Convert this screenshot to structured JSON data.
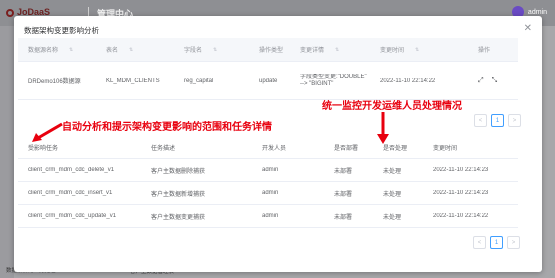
{
  "background": {
    "logo_text": "JoDaaS",
    "app_title": "管理中心",
    "user_name": "admin",
    "bottom_left_text": "数据解析的业务处理",
    "bottom_mid_text": "客户主数据管理表"
  },
  "modal": {
    "title": "数据架构变更影响分析",
    "close_icon": "close-icon"
  },
  "table1": {
    "columns": [
      "数据源名称",
      "表名",
      "字段名",
      "操作类型",
      "变更详情",
      "变更时间",
      "操作"
    ],
    "row": {
      "datasource": "DRDemo106数据源",
      "table": "KL_MDM_CLIENTS",
      "field": "reg_capital",
      "op_type": "update",
      "detail": "字段类型变更:\"DOUBLE\" --> \"BIGINT\"",
      "time": "2022-11-10 22:14:22"
    }
  },
  "pagination": {
    "prev": "<",
    "page": "1",
    "next": ">"
  },
  "table2": {
    "columns": [
      "受影响任务",
      "任务描述",
      "开发人员",
      "是否部署",
      "是否处理",
      "变更时间"
    ],
    "rows": [
      {
        "task": "client_crm_mdm_cdc_delete_v1",
        "desc": "客户主数据删除捕获",
        "dev": "admin",
        "deployed": "未部署",
        "handled": "未处理",
        "time": "2022-11-10 22:14:23"
      },
      {
        "task": "client_crm_mdm_cdc_insert_v1",
        "desc": "客户主数据新增捕获",
        "dev": "admin",
        "deployed": "未部署",
        "handled": "未处理",
        "time": "2022-11-10 22:14:23"
      },
      {
        "task": "client_crm_mdm_cdc_update_v1",
        "desc": "客户主数据变更捕获",
        "dev": "admin",
        "deployed": "未部署",
        "handled": "未处理",
        "time": "2022-11-10 22:14:22"
      }
    ]
  },
  "annotations": {
    "top": "统一监控开发运维人员处理情况",
    "left": "自动分析和提示架构变更影响的范围和任务详情"
  },
  "colors": {
    "annotation": "#e8000e",
    "accent": "#409eff"
  }
}
